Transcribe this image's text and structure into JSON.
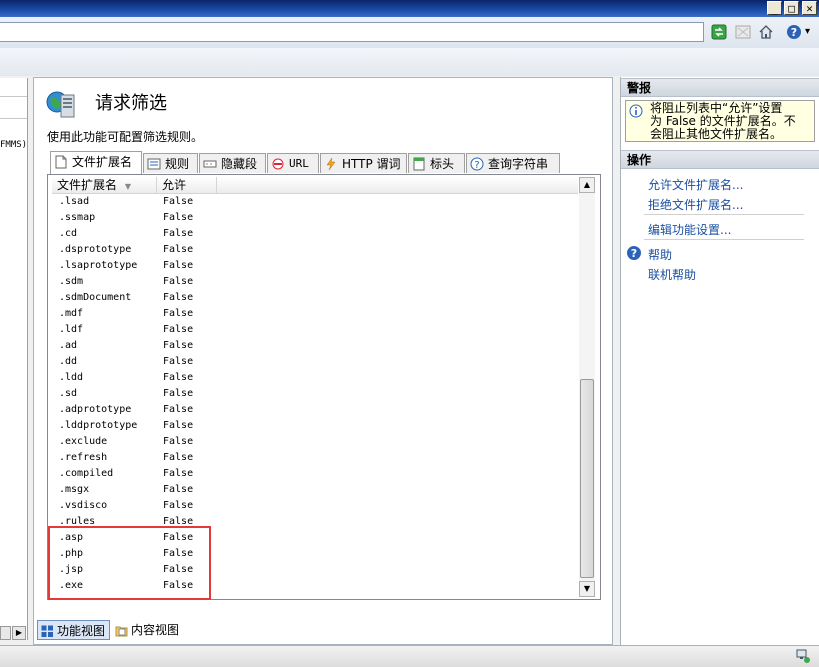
{
  "window": {
    "buttons": {
      "minimize": "_",
      "maximize": "□",
      "close": "✕"
    }
  },
  "toolbar": {
    "icons": [
      "refresh-icon",
      "stop-icon",
      "home-icon",
      "help-icon"
    ],
    "help_dropdown": "▾"
  },
  "left_panel": {
    "truncated_text": "FMMS)"
  },
  "center": {
    "title": "请求筛选",
    "description": "使用此功能可配置筛选规则。",
    "tabs": [
      {
        "label": "文件扩展名",
        "icon": "file-icon",
        "active": true
      },
      {
        "label": "规则",
        "icon": "rules-icon",
        "active": false
      },
      {
        "label": "隐藏段",
        "icon": "hidden-segment-icon",
        "active": false
      },
      {
        "label": "URL",
        "icon": "url-icon",
        "active": false
      },
      {
        "label": "HTTP 谓词",
        "icon": "lightning-icon",
        "active": false
      },
      {
        "label": "标头",
        "icon": "header-icon",
        "active": false
      },
      {
        "label": "查询字符串",
        "icon": "query-icon",
        "active": false
      }
    ],
    "columns": [
      "文件扩展名",
      "允许"
    ],
    "rows": [
      {
        "ext": ".lsad",
        "allowed": "False"
      },
      {
        "ext": ".ssmap",
        "allowed": "False"
      },
      {
        "ext": ".cd",
        "allowed": "False"
      },
      {
        "ext": ".dsprototype",
        "allowed": "False"
      },
      {
        "ext": ".lsaprototype",
        "allowed": "False"
      },
      {
        "ext": ".sdm",
        "allowed": "False"
      },
      {
        "ext": ".sdmDocument",
        "allowed": "False"
      },
      {
        "ext": ".mdf",
        "allowed": "False"
      },
      {
        "ext": ".ldf",
        "allowed": "False"
      },
      {
        "ext": ".ad",
        "allowed": "False"
      },
      {
        "ext": ".dd",
        "allowed": "False"
      },
      {
        "ext": ".ldd",
        "allowed": "False"
      },
      {
        "ext": ".sd",
        "allowed": "False"
      },
      {
        "ext": ".adprototype",
        "allowed": "False"
      },
      {
        "ext": ".lddprototype",
        "allowed": "False"
      },
      {
        "ext": ".exclude",
        "allowed": "False"
      },
      {
        "ext": ".refresh",
        "allowed": "False"
      },
      {
        "ext": ".compiled",
        "allowed": "False"
      },
      {
        "ext": ".msgx",
        "allowed": "False"
      },
      {
        "ext": ".vsdisco",
        "allowed": "False"
      },
      {
        "ext": ".rules",
        "allowed": "False"
      },
      {
        "ext": ".asp",
        "allowed": "False"
      },
      {
        "ext": ".php",
        "allowed": "False"
      },
      {
        "ext": ".jsp",
        "allowed": "False"
      },
      {
        "ext": ".exe",
        "allowed": "False"
      }
    ],
    "bottom_tabs": [
      {
        "label": "功能视图",
        "icon": "feature-view-icon",
        "active": true
      },
      {
        "label": "内容视图",
        "icon": "content-view-icon",
        "active": false
      }
    ]
  },
  "right_panel": {
    "alerts_title": "警报",
    "alert_text_1": "将阻止列表中“允许”设置",
    "alert_text_2": "为 False 的文件扩展名。不",
    "alert_text_3": "会阻止其他文件扩展名。",
    "actions_title": "操作",
    "actions": [
      {
        "label": "允许文件扩展名..."
      },
      {
        "label": "拒绝文件扩展名..."
      },
      {
        "label": "编辑功能设置..."
      },
      {
        "label": "帮助"
      },
      {
        "label": "联机帮助"
      }
    ]
  },
  "colors": {
    "titlebar": "#0a246a",
    "link": "#1a4fa0",
    "highlight": "#e23a3a"
  }
}
